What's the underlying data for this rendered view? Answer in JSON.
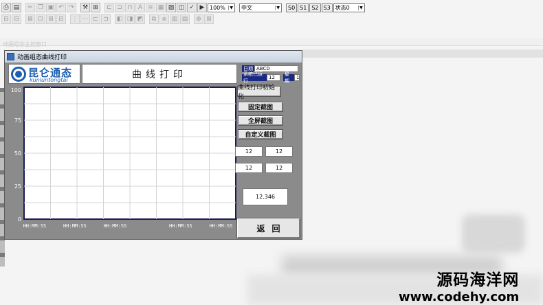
{
  "toolbar": {
    "zoom_value": "100%",
    "language_value": "中文",
    "s_buttons": [
      "S0",
      "S1",
      "S2",
      "S3"
    ],
    "state_value": "状态0"
  },
  "background_window_title": "动画组态主控窗口",
  "window": {
    "title": "动画组态曲线打印"
  },
  "logo": {
    "cn": "昆仑通态",
    "en": "kunluntongtai"
  },
  "main_title": "曲线打印",
  "info": {
    "date_label": "日期",
    "date_value": "ABCD",
    "runtime_label": "系统已运行",
    "runtime_value": "12",
    "week_label": "星期",
    "week_value": "1"
  },
  "chart_data": {
    "type": "line",
    "y_ticks": [
      "100",
      "75",
      "50",
      "25",
      "0"
    ],
    "ylim": [
      0,
      100
    ],
    "x_tick_labels": [
      "HH:MM:SS",
      "HH:MM:SS",
      "HH:MM:SS",
      "HH:MM:SS",
      "HH:MM:SS"
    ],
    "grid": true,
    "series": []
  },
  "buttons": {
    "init_print": "曲线打印初始化",
    "fixed_capture": "固定截图",
    "fullscreen_capture": "全屏截图",
    "custom_capture": "自定义截图",
    "return": "返回"
  },
  "values": {
    "v1": "12",
    "v2": "12",
    "v3": "12",
    "v4": "12",
    "v5": "12.346"
  },
  "watermark": {
    "line1": "源码海洋网",
    "line2": "www.codehy.com"
  }
}
